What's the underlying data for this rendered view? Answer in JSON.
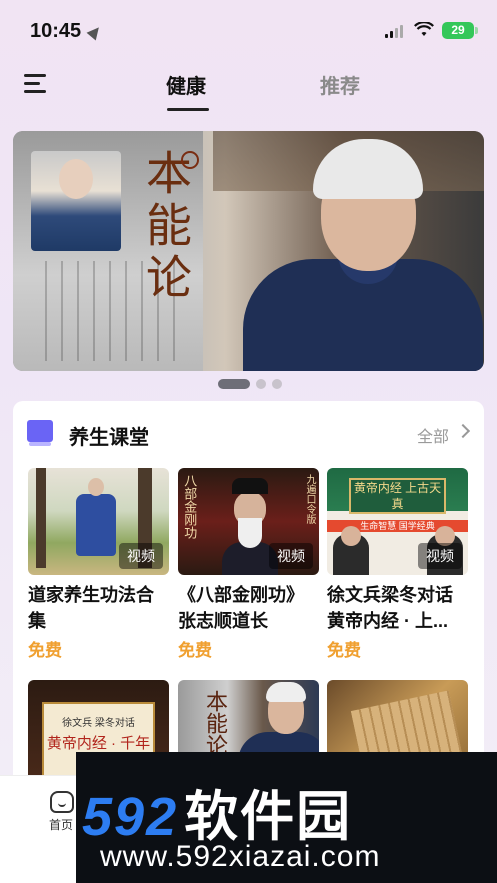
{
  "status_bar": {
    "time": "10:45",
    "battery": "29"
  },
  "nav": {
    "tab_active": "健康",
    "tab_inactive": "推荐"
  },
  "banner": {
    "calligraphy": "本能论"
  },
  "section": {
    "title": "养生课堂",
    "see_all": "全部"
  },
  "courses": [
    {
      "title": "道家养生功法合集",
      "price": "免费",
      "badge": "视频"
    },
    {
      "title": "《八部金刚功》张志顺道长",
      "price": "免费",
      "badge": "视频",
      "thumb_text": "八部金刚功",
      "thumb_side": "九遍口令版"
    },
    {
      "title": "徐文兵梁冬对话黄帝内经 · 上...",
      "price": "免费",
      "badge": "视频",
      "thumb_book": "黄帝内经 上古天真",
      "thumb_band": "生命智慧 国学经典"
    }
  ],
  "courses_row2": [
    {
      "thumb_top": "徐文兵 梁冬对话",
      "thumb_center": "黄帝内经 · 千年"
    },
    {
      "thumb_text": "本能论"
    },
    {}
  ],
  "tabbar": {
    "home_label": "首页"
  },
  "watermark": {
    "brand_num": "592",
    "brand_cn": "软件园",
    "url": "www.592xiazai.com"
  },
  "colors": {
    "accent_purple": "#6a64f5",
    "price_orange": "#f0a030",
    "watermark_blue": "#2d7df2"
  }
}
